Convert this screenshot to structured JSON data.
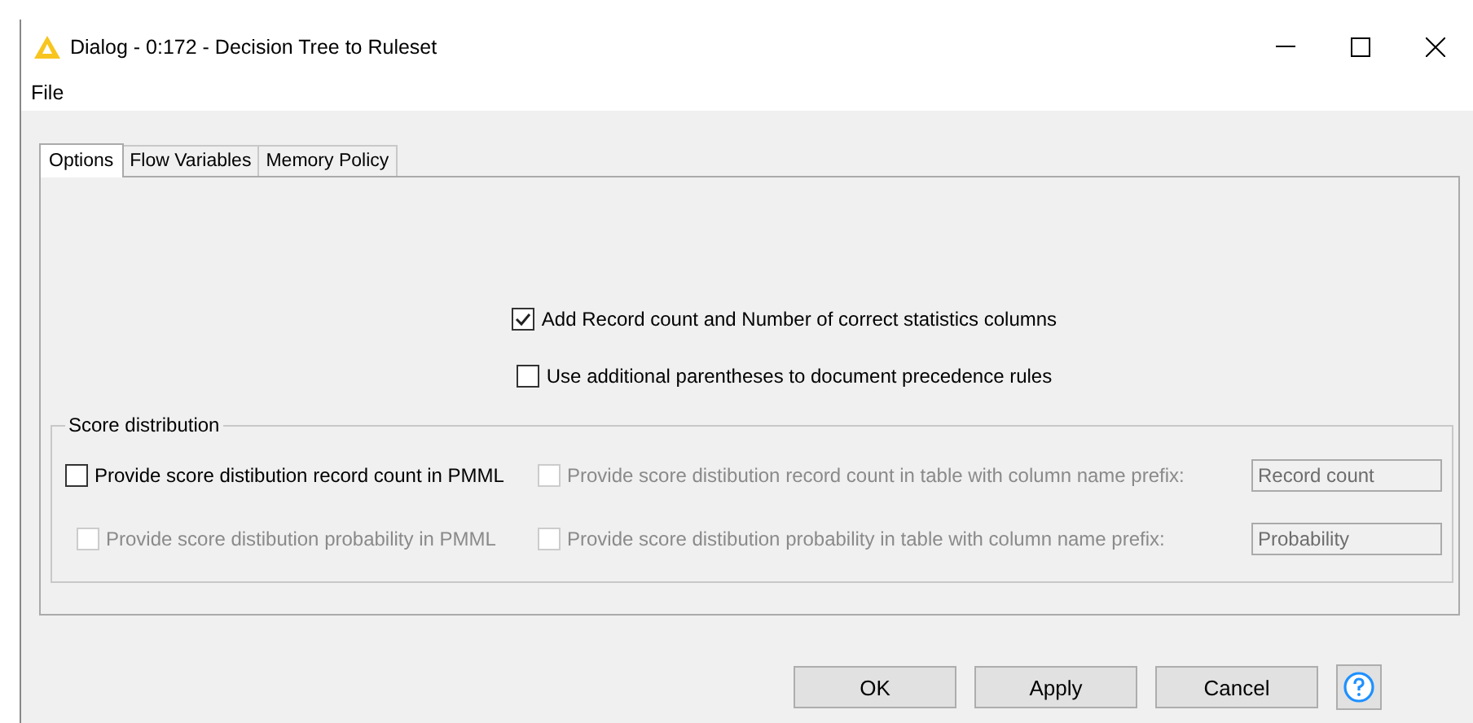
{
  "window": {
    "title": "Dialog - 0:172 - Decision Tree to Ruleset"
  },
  "menu": [
    "File"
  ],
  "tabs": [
    {
      "label": "Options",
      "selected": true
    },
    {
      "label": "Flow Variables",
      "selected": false
    },
    {
      "label": "Memory Policy",
      "selected": false
    }
  ],
  "options": [
    {
      "label": "Add Record count and Number of correct statistics columns",
      "checked": true,
      "disabled": false
    },
    {
      "label": "Use additional parentheses to document precedence rules",
      "checked": false,
      "disabled": false
    }
  ],
  "score_distribution": {
    "title": "Score distribution",
    "rows": [
      {
        "pmml": {
          "label": "Provide score distibution record count in PMML",
          "checked": false,
          "disabled": false
        },
        "table": {
          "label": "Provide score distibution record count in table with column name prefix:",
          "checked": false,
          "disabled": true
        },
        "prefix": {
          "value": "Record count",
          "disabled": true
        }
      },
      {
        "pmml": {
          "label": "Provide score distibution probability in PMML",
          "checked": false,
          "disabled": true
        },
        "table": {
          "label": "Provide score distibution probability in table with column name prefix:",
          "checked": false,
          "disabled": true
        },
        "prefix": {
          "value": "Probability",
          "disabled": true
        }
      }
    ]
  },
  "buttons": [
    "OK",
    "Apply",
    "Cancel"
  ]
}
